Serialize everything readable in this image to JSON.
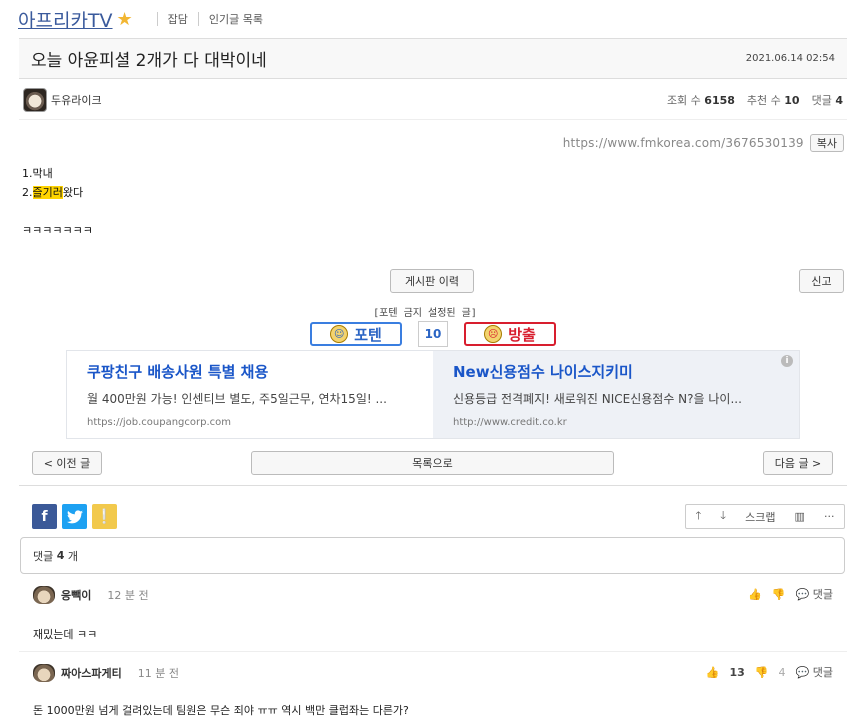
{
  "header": {
    "board_name": "아프리카TV",
    "crumbs": [
      "잡담",
      "인기글 목록"
    ]
  },
  "post": {
    "title": "오늘 아윤피셜 2개가 다 대박이네",
    "date": "2021.06.14 02:54",
    "author": "두유라이크",
    "views_label": "조회 수",
    "views": "6158",
    "recommends_label": "추천 수",
    "recommends": "10",
    "comments_label": "댓글",
    "comments": "4",
    "url": "https://www.fmkorea.com/3676530139",
    "copy_label": "복사",
    "lines": {
      "l1": "1.막내",
      "l2_pre": "2.",
      "l2_hl": "즐기러",
      "l2_post": "왔다",
      "l3": "ㅋㅋㅋㅋㅋㅋㅋ"
    }
  },
  "actions": {
    "history": "게시판 이력",
    "report": "신고",
    "ban_notice": "[포텐 금지 설정된 글]",
    "up_label": "포텐",
    "vote_count": "10",
    "down_label": "방출"
  },
  "ads": [
    {
      "headline": "쿠팡친구 배송사원 특별 채용",
      "desc": "월 400만원 가능! 인센티브 별도, 주5일근무, 연차15일! ...",
      "url": "https://job.coupangcorp.com"
    },
    {
      "headline": "New신용점수 나이스지키미",
      "desc": "신용등급 전격폐지! 새로워진 NICE신용점수 N?을 나이...",
      "url": "http://www.credit.co.kr"
    }
  ],
  "nav": {
    "prev": "< 이전 글",
    "list": "목록으로",
    "next": "다음 글 >"
  },
  "tools": {
    "scrap": "스크랩"
  },
  "comment_header": {
    "label": "댓글",
    "count": "4",
    "unit": "개"
  },
  "comments": [
    {
      "nick": "응빽이",
      "time": "12 분 전",
      "up": "",
      "down": "",
      "reply": "댓글",
      "text": "재밌는데 ㅋㅋ"
    },
    {
      "nick": "짜아스파게티",
      "time": "11 분 전",
      "up": "13",
      "down": "4",
      "reply": "댓글",
      "text": "돈 1000만원 넘게 걸려있는데 팀원은 무슨 죄야 ㅠㅠ 역시 백만 클럽좌는 다른가?"
    }
  ]
}
